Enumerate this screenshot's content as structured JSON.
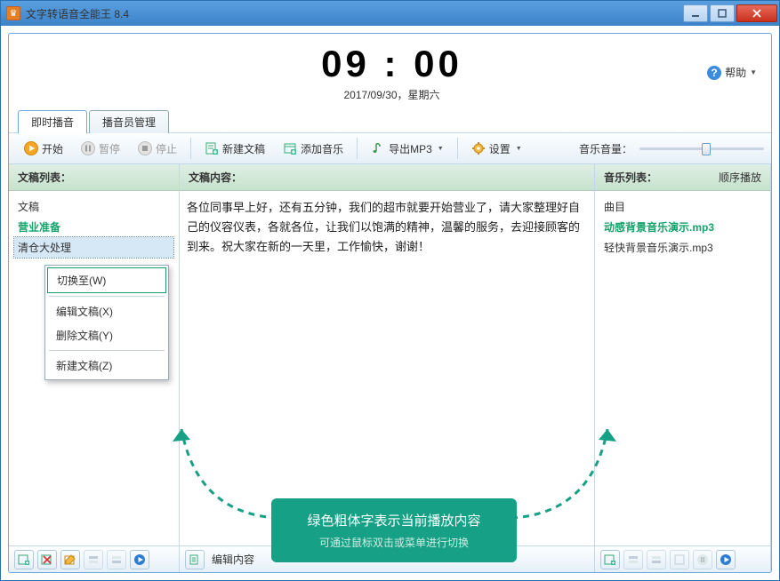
{
  "window": {
    "title": "文字转语音全能王 8.4"
  },
  "header": {
    "clock": "09 : 00",
    "date": "2017/09/30，星期六",
    "help": "帮助"
  },
  "tabs": [
    {
      "label": "即时播音",
      "active": true
    },
    {
      "label": "播音员管理",
      "active": false
    }
  ],
  "toolbar": {
    "play": "开始",
    "pause": "暂停",
    "stop": "停止",
    "new_doc": "新建文稿",
    "add_music": "添加音乐",
    "export_mp3": "导出MP3",
    "settings": "设置",
    "volume_label": "音乐音量："
  },
  "left": {
    "header": "文稿列表：",
    "items_title": "文稿",
    "items": [
      {
        "label": "营业准备",
        "active": true,
        "selected": false
      },
      {
        "label": "清仓大处理",
        "active": false,
        "selected": true
      }
    ]
  },
  "context_menu": {
    "switch": "切换至(W)",
    "edit": "编辑文稿(X)",
    "delete": "删除文稿(Y)",
    "new": "新建文稿(Z)"
  },
  "mid": {
    "header": "文稿内容：",
    "text": "各位同事早上好，还有五分钟，我们的超市就要开始营业了，请大家整理好自己的仪容仪表，各就各位，让我们以饱满的精神，温馨的服务，去迎接顾客的到来。祝大家在新的一天里，工作愉快，谢谢！",
    "footer_label": "编辑内容"
  },
  "right": {
    "header": "音乐列表：",
    "order": "顺序播放",
    "items_title": "曲目",
    "items": [
      {
        "label": "动感背景音乐演示.mp3",
        "active": true
      },
      {
        "label": "轻快背景音乐演示.mp3",
        "active": false
      }
    ]
  },
  "callout": {
    "line1": "绿色粗体字表示当前播放内容",
    "line2": "可通过鼠标双击或菜单进行切换"
  }
}
